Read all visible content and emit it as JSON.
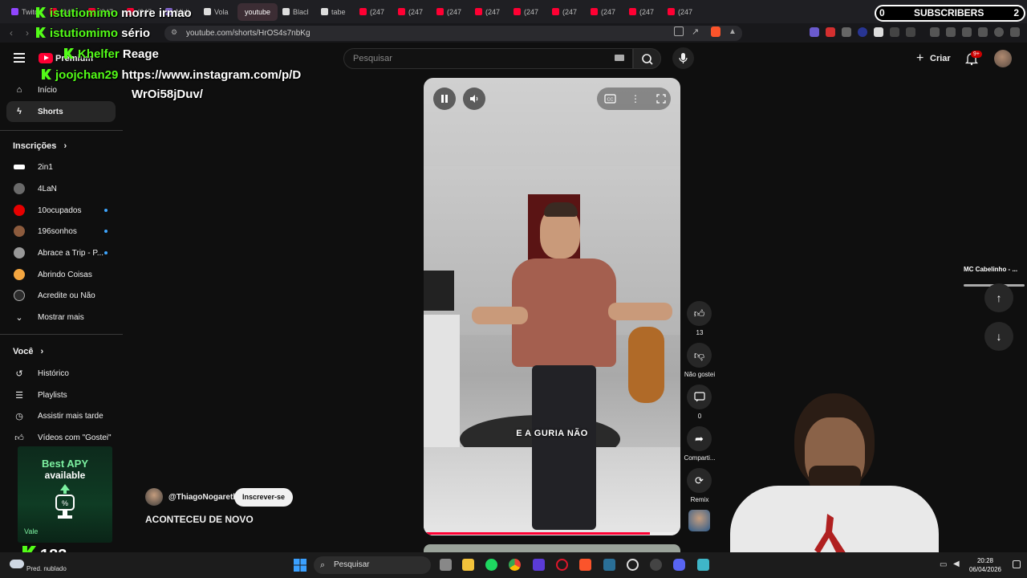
{
  "browser": {
    "tabs": [
      {
        "label": "Twitc",
        "color": "#9146ff"
      },
      {
        "label": "(247",
        "color": "#ff0033"
      },
      {
        "label": "(247",
        "color": "#ff0033"
      },
      {
        "label": "(247",
        "color": "#ff0033"
      },
      {
        "label": "Midj",
        "color": "#8a6bd8"
      },
      {
        "label": "Vola",
        "color": "#dddddd"
      },
      {
        "label": "youtube",
        "color": "#ff0033",
        "active": true
      },
      {
        "label": "Blacl",
        "color": "#dddddd"
      },
      {
        "label": "tabe",
        "color": "#dddddd"
      },
      {
        "label": "(247",
        "color": "#ff0033"
      },
      {
        "label": "(247",
        "color": "#ff0033"
      },
      {
        "label": "(247",
        "color": "#ff0033"
      },
      {
        "label": "(247",
        "color": "#ff0033"
      },
      {
        "label": "(247",
        "color": "#ff0033"
      },
      {
        "label": "(247",
        "color": "#ff0033"
      },
      {
        "label": "(247",
        "color": "#ff0033"
      },
      {
        "label": "(247",
        "color": "#ff0033"
      },
      {
        "label": "(247",
        "color": "#ff0033"
      }
    ],
    "url": "youtube.com/shorts/HrOS4s7nbKg"
  },
  "stream_overlay": {
    "subscribers_label": "SUBSCRIBERS",
    "subscribers_left": "0",
    "subscribers_right": "2",
    "chat": [
      {
        "user": "istutiomimo",
        "message": "morre irmao"
      },
      {
        "user": "istutiomimo",
        "message": "sério"
      },
      {
        "user": "Khelfer",
        "message": "Reage"
      },
      {
        "user": "joojchan29",
        "message": "https://www.instagram.com/p/D"
      },
      {
        "user": "",
        "message": "WrOi58jDuv/"
      }
    ],
    "follower_count": "183"
  },
  "header": {
    "logo_text": "Premium",
    "search_placeholder": "Pesquisar",
    "create_label": "Criar",
    "notifications_badge": "9+"
  },
  "sidebar": {
    "main": [
      {
        "label": "Início",
        "icon": "home-icon"
      },
      {
        "label": "Shorts",
        "icon": "shorts-icon",
        "active": true
      }
    ],
    "subscriptions_heading": "Inscrições",
    "subscriptions": [
      {
        "label": "2in1",
        "color": "#ffffff",
        "dot": false
      },
      {
        "label": "4LaN",
        "color": "#6a6a6a",
        "dot": false
      },
      {
        "label": "10ocupados",
        "color": "#e60000",
        "dot": true
      },
      {
        "label": "196sonhos",
        "color": "#8c5b3d",
        "dot": true
      },
      {
        "label": "Abrace a Trip - P...",
        "color": "#999999",
        "dot": true
      },
      {
        "label": "Abrindo Coisas",
        "color": "#f4a640",
        "dot": false
      },
      {
        "label": "Acredite ou Não",
        "color": "#2c2c2c",
        "dot": false
      }
    ],
    "show_more": "Mostrar mais",
    "you_heading": "Você",
    "you": [
      {
        "label": "Histórico",
        "icon": "history-icon"
      },
      {
        "label": "Playlists",
        "icon": "playlists-icon"
      },
      {
        "label": "Assistir mais tarde",
        "icon": "clock-icon"
      },
      {
        "label": "Vídeos com \"Gostei\"",
        "icon": "like-icon"
      }
    ]
  },
  "ad": {
    "title_line1": "Best APY",
    "title_line2": "available",
    "tag": "Vale"
  },
  "video": {
    "caption": "E A GURIA NÃO",
    "progress": 0.88,
    "author": "@ThiagoNogareth",
    "subscribe_label": "Inscrever-se",
    "title": "ACONTECEU DE NOVO",
    "likes": "13",
    "dislike_label": "Não gostei",
    "comments": "0",
    "share_label": "Comparti...",
    "remix_label": "Remix"
  },
  "mini_player": {
    "title": "MC Cabelinho - ..."
  },
  "taskbar": {
    "search_placeholder": "Pesquisar",
    "weather": "Pred. nublado",
    "time": "20:28",
    "date": "06/04/2026"
  }
}
